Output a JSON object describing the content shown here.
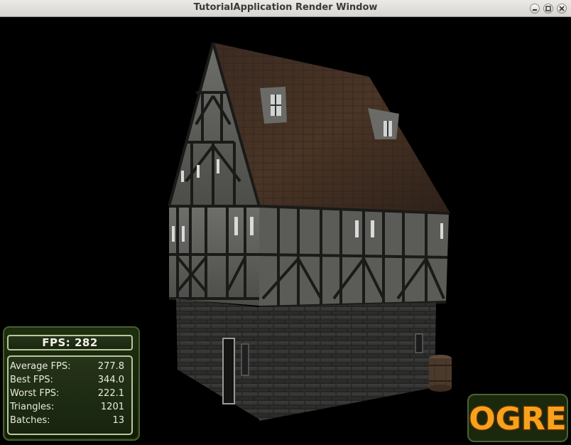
{
  "window": {
    "title": "TutorialApplication Render Window",
    "controls": [
      "minimize-icon",
      "maximize-icon",
      "close-icon"
    ]
  },
  "stats": {
    "fps_label": "FPS:",
    "fps_value": "282",
    "rows": [
      {
        "label": "Average FPS:",
        "value": "277.8"
      },
      {
        "label": "Best FPS:",
        "value": "344.0"
      },
      {
        "label": "Worst FPS:",
        "value": "222.1"
      },
      {
        "label": "Triangles:",
        "value": "1201"
      },
      {
        "label": "Batches:",
        "value": "13"
      }
    ]
  },
  "logo": {
    "text": "OGRE"
  },
  "colors": {
    "titlebar": "#dcd9d5",
    "panel_border": "#b8c89c",
    "panel_bg": "#1c2a10",
    "logo_fill": "#f7a21b"
  }
}
